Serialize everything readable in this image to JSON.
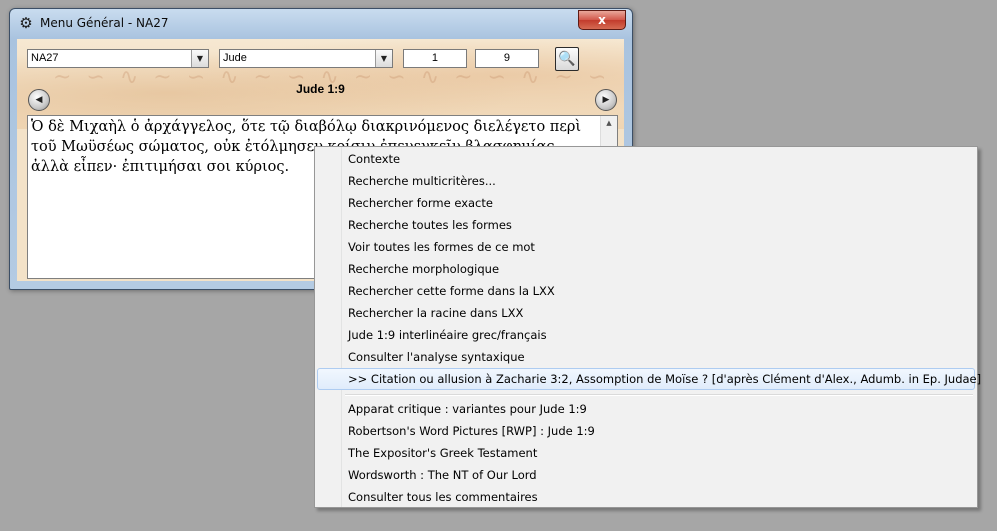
{
  "window": {
    "title": "Menu Général - NA27",
    "close_label": "x"
  },
  "toolbar": {
    "edition": "NA27",
    "book": "Jude",
    "chapter": "1",
    "verse": "9",
    "search_icon": "search-magnifier-icon"
  },
  "reference": "Jude 1:9",
  "passage_text": "Ὁ δὲ Μιχαὴλ ὁ ἀρχάγγελος, ὅτε τῷ διαβόλῳ διακρινόμενος διελέγετο περὶ τοῦ Μωϋσέως σώματος, οὐκ ἐτόλμησεν κρίσιν ἐπενεγκεῖν βλασφημίας ἀλλὰ εἶπεν· ἐπιτιμήσαι σοι κύριος.",
  "context_menu": {
    "items": [
      "Contexte",
      "Recherche multicritères...",
      "Rechercher forme exacte",
      "Recherche toutes les formes",
      "Voir toutes les formes de ce mot",
      "Recherche morphologique",
      "Rechercher cette forme dans la LXX",
      "Rechercher la racine dans LXX",
      "Jude 1:9 interlinéaire grec/français",
      "Consulter l'analyse syntaxique",
      ">> Citation ou allusion à Zacharie 3:2, Assomption de Moïse ? [d'après Clément d'Alex., Adumb. in Ep. Judae]",
      "Apparat critique : variantes pour Jude 1:9",
      "Robertson's Word Pictures [RWP] : Jude 1:9",
      "The Expositor's Greek Testament",
      "Wordsworth : The NT of Our Lord",
      "Consulter tous les commentaires"
    ],
    "highlighted_index": 10
  },
  "colors": {
    "desktop": "#a6a6a6",
    "window_frame": "#b4cbe3",
    "parchment": "#f3e2c8",
    "menu_background": "#f1f1f1",
    "menu_highlight": "#e0ecfb",
    "close_button": "#c23b2c"
  }
}
